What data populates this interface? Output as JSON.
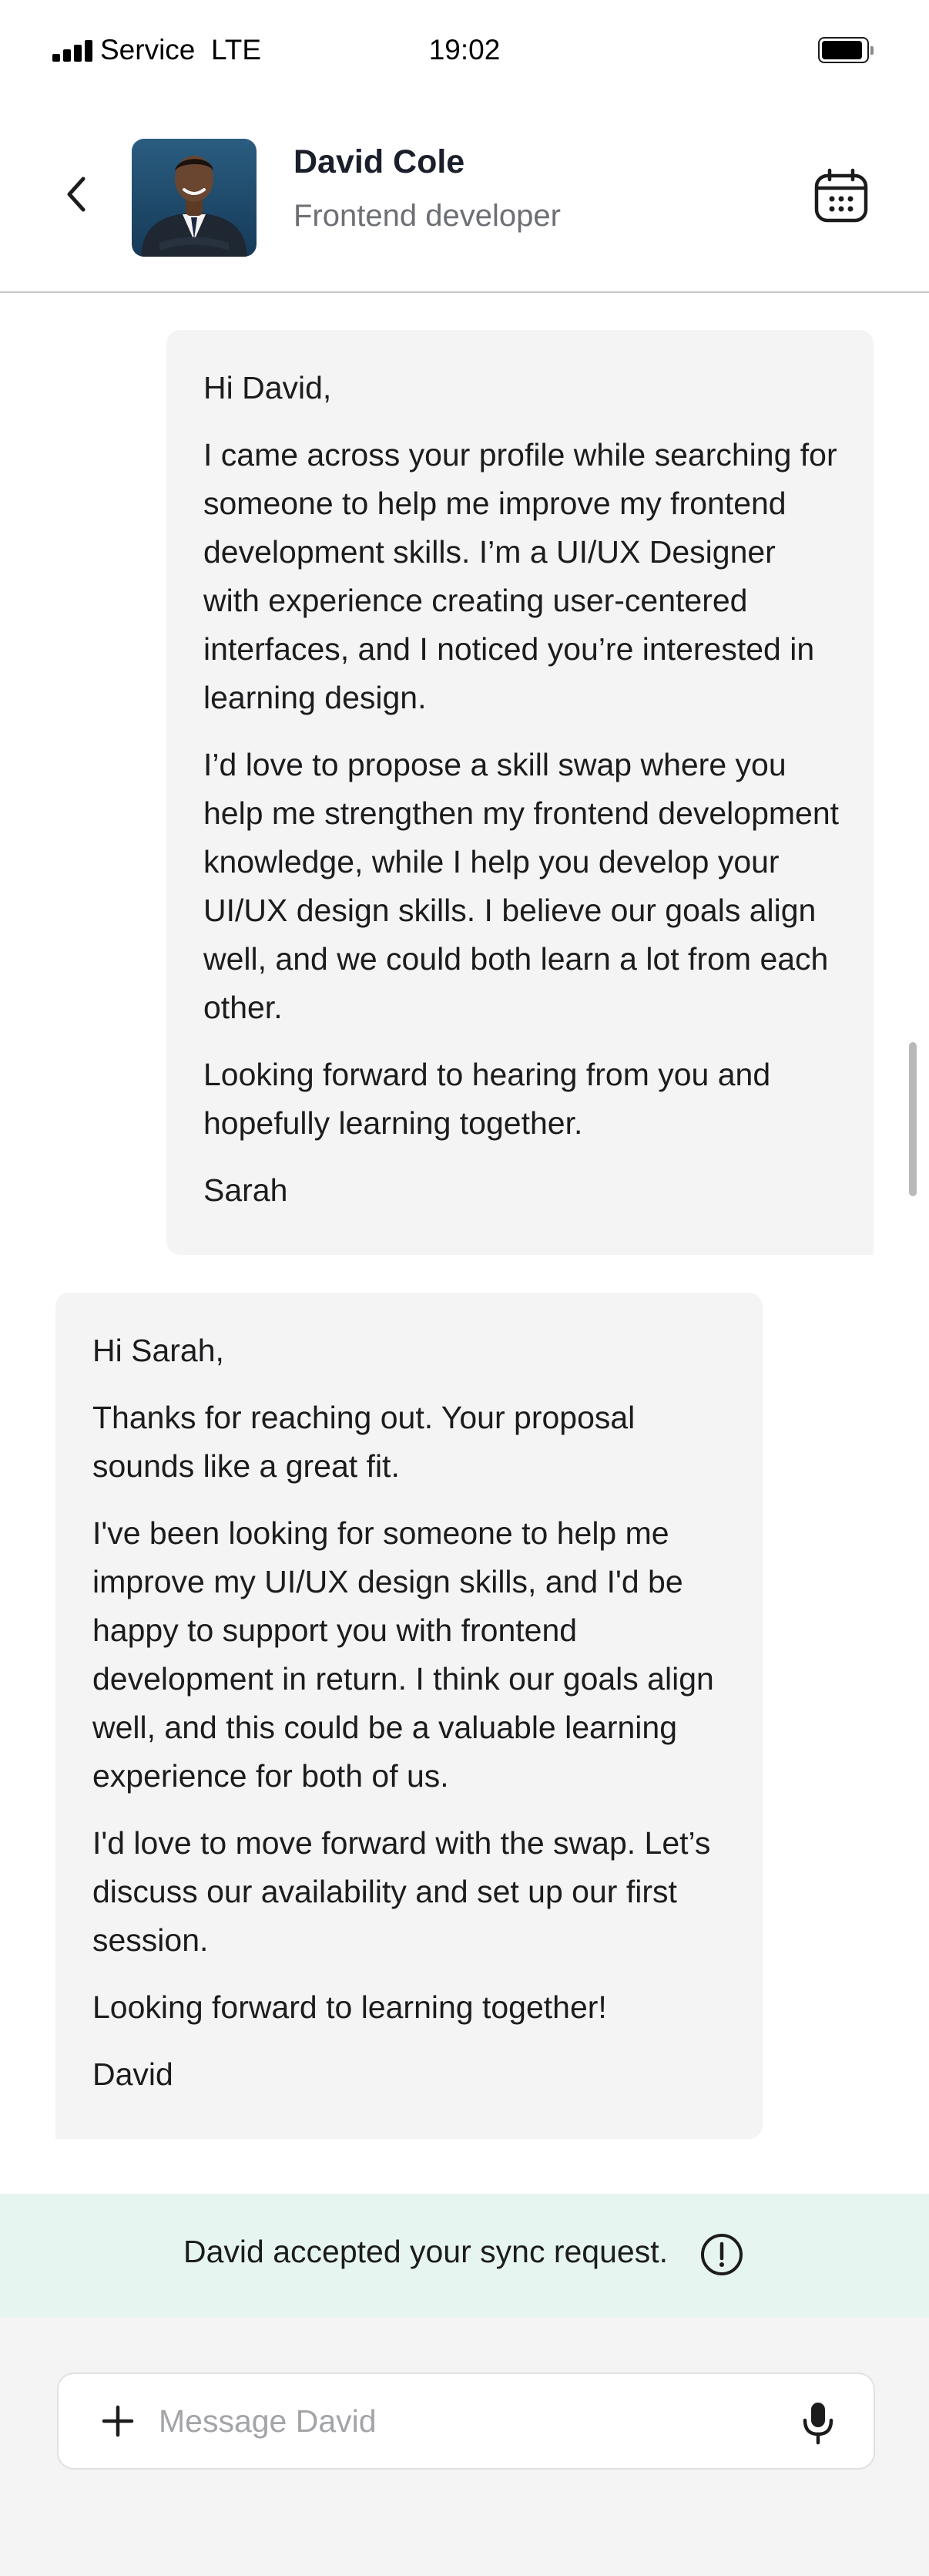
{
  "status_bar": {
    "carrier": "Service",
    "network": "LTE",
    "time": "19:02"
  },
  "header": {
    "contact_name": "David Cole",
    "contact_role": "Frontend developer",
    "icons": [
      "back-chevron-icon",
      "calendar-icon"
    ]
  },
  "messages": [
    {
      "direction": "outgoing",
      "paragraphs": [
        "Hi David,",
        "I came across your profile while searching for someone to help me improve my frontend development skills. I’m a UI/UX Designer with experience creating user-centered interfaces, and I noticed you’re interested in learning design.",
        "I’d love to propose a skill swap where you help me strengthen my frontend development knowledge, while I help you develop your UI/UX design skills. I believe our goals align well, and we could both learn a lot from each other.",
        "Looking forward to hearing from you and hopefully learning together.",
        "Sarah"
      ]
    },
    {
      "direction": "incoming",
      "paragraphs": [
        "Hi Sarah,",
        "Thanks for reaching out. Your proposal sounds like a great fit.",
        "I've been looking for someone to help me improve my UI/UX design skills, and I'd be happy to support you with frontend development in return. I think our goals align well, and this could be a valuable learning experience for both of us.",
        "I'd love to move forward with the swap. Let’s discuss our availability and set up our first session.",
        "Looking forward to learning together!",
        "David"
      ]
    }
  ],
  "notice": {
    "text": "David accepted your sync request.",
    "icon": "info-icon"
  },
  "composer": {
    "placeholder": "Message David",
    "value": "",
    "icons": [
      "plus-icon",
      "microphone-icon"
    ]
  },
  "colors": {
    "bubble_bg": "#f4f4f5",
    "notice_bg": "#e7f5f0",
    "composer_bg": "#f4f4f5",
    "primary_text": "#1c1c1e",
    "secondary_text": "#6d6f75"
  }
}
